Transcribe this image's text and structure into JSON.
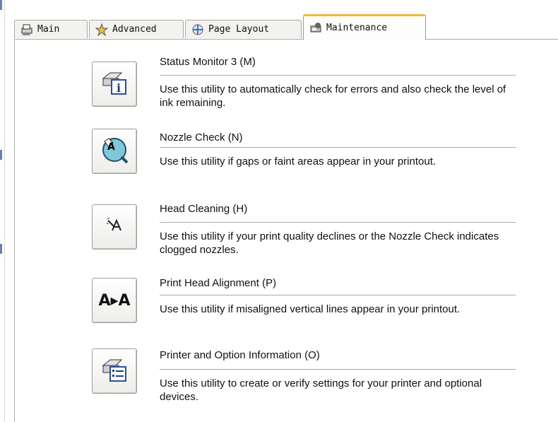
{
  "tabs": [
    {
      "label": "Main",
      "icon": "printer-icon"
    },
    {
      "label": "Advanced",
      "icon": "settings-star-icon"
    },
    {
      "label": "Page Layout",
      "icon": "page-layout-icon"
    },
    {
      "label": "Maintenance",
      "icon": "maintenance-icon",
      "active": true
    }
  ],
  "utilities": [
    {
      "title": "Status Monitor 3 (M)",
      "description": "Use this utility to automatically check for errors and also check the level of ink remaining.",
      "icon": "status-monitor-icon"
    },
    {
      "title": "Nozzle Check (N)",
      "description": "Use this utility if gaps or faint areas appear in your printout.",
      "icon": "nozzle-check-icon"
    },
    {
      "title": "Head Cleaning (H)",
      "description": "Use this utility if your print quality declines or the Nozzle Check indicates clogged nozzles.",
      "icon": "head-cleaning-icon"
    },
    {
      "title": "Print Head Alignment (P)",
      "description": "Use this utility if misaligned vertical lines appear in your printout.",
      "icon": "print-head-alignment-icon",
      "icon_text": "A▸A"
    },
    {
      "title": "Printer and Option Information (O)",
      "description": "Use this utility to create or verify settings for your printer and optional devices.",
      "icon": "printer-info-icon"
    }
  ],
  "colors": {
    "active_tab_accent": "#f5b642",
    "accent_blue": "#2a4f9e"
  }
}
